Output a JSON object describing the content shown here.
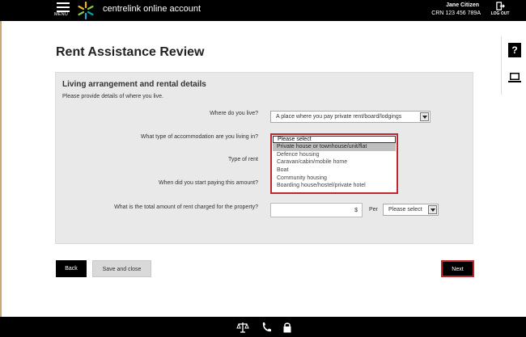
{
  "header": {
    "menu_label": "MENU",
    "brand": "centrelink online account",
    "user_name": "Jane Citizen",
    "crn": "CRN  123 456 789A",
    "logout_label": "LOG OUT"
  },
  "side_tools": {
    "help_label": "?"
  },
  "page": {
    "title": "Rent Assistance Review"
  },
  "section": {
    "title": "Living arrangement and rental details",
    "description": "Please provide details of where you live."
  },
  "questions": {
    "where_live": {
      "label": "Where do you live?",
      "value": "A place where you pay private rent/board/lodgings"
    },
    "accommodation": {
      "label": "What type of accommodation are you living in?",
      "selected": "Please select",
      "options": [
        "Private house or townhouse/unit/flat",
        "Defence housing",
        "Caravan/cabin/mobile home",
        "Boat",
        "Community housing",
        "Boarding house/hostel/private hotel"
      ],
      "highlighted_index": 0
    },
    "type_of_rent": {
      "label": "Type of rent"
    },
    "start_paying": {
      "label": "When did you start paying this amount?"
    },
    "rent_amount": {
      "label": "What is the total amount of rent charged for the property?",
      "currency_symbol": "$",
      "per_label": "Per",
      "per_value": "Please select"
    }
  },
  "buttons": {
    "back": "Back",
    "save_close": "Save and close",
    "next": "Next"
  },
  "colors": {
    "header_bg": "#000000",
    "accent_red": "#c0272d",
    "dropdown_selected_bg": "#1e1e9a",
    "panel_bg": "#e9e9e9"
  },
  "icons": {
    "footer": [
      "scales-icon",
      "phone-icon",
      "lock-icon"
    ]
  }
}
